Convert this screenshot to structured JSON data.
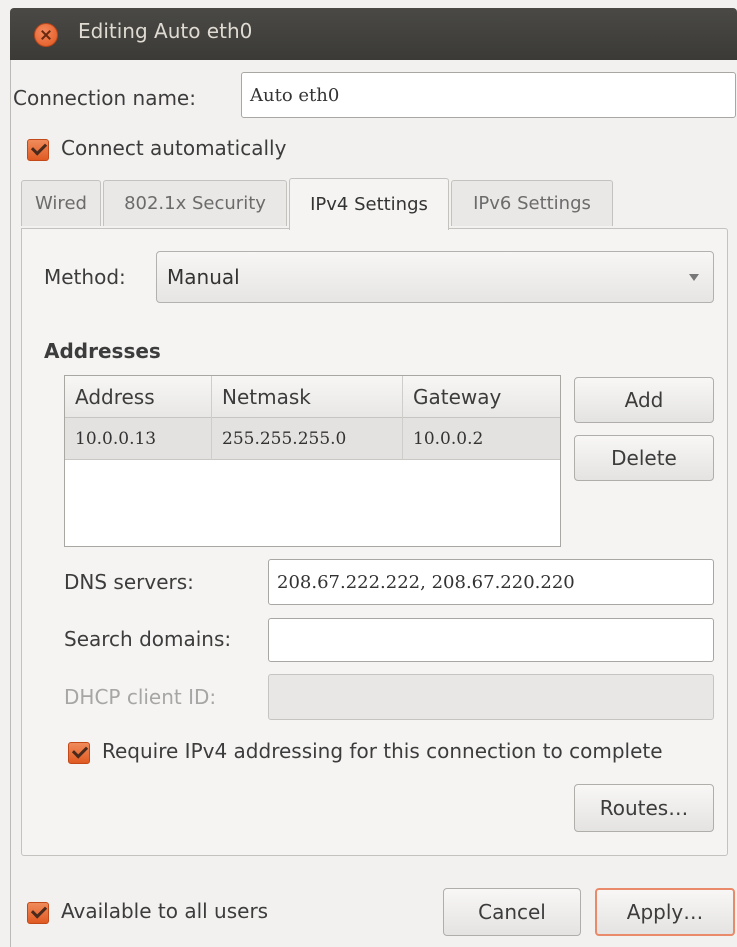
{
  "window": {
    "title": "Editing Auto eth0"
  },
  "connection": {
    "label": "Connection name:",
    "value": "Auto eth0"
  },
  "connect_auto": {
    "label": "Connect automatically",
    "checked": true
  },
  "tabs": [
    {
      "label": "Wired"
    },
    {
      "label": "802.1x Security"
    },
    {
      "label": "IPv4 Settings",
      "active": true
    },
    {
      "label": "IPv6 Settings"
    }
  ],
  "method": {
    "label": "Method:",
    "value": "Manual"
  },
  "addresses": {
    "title": "Addresses",
    "columns": [
      "Address",
      "Netmask",
      "Gateway"
    ],
    "rows": [
      [
        "10.0.0.13",
        "255.255.255.0",
        "10.0.0.2"
      ]
    ],
    "add_label": "Add",
    "delete_label": "Delete"
  },
  "dns": {
    "label": "DNS servers:",
    "value": "208.67.222.222, 208.67.220.220"
  },
  "search_domains": {
    "label": "Search domains:",
    "value": ""
  },
  "dhcp_client_id": {
    "label": "DHCP client ID:",
    "value": ""
  },
  "require_ipv4": {
    "label": "Require IPv4 addressing for this connection to complete",
    "checked": true
  },
  "routes_label": "Routes…",
  "available_all": {
    "label": "Available to all users",
    "checked": true
  },
  "footer": {
    "cancel_label": "Cancel",
    "apply_label": "Apply…"
  },
  "colors": {
    "accent": "#e05a22",
    "titlebar": "#3b3a36",
    "default_border": "#e98a6a"
  }
}
